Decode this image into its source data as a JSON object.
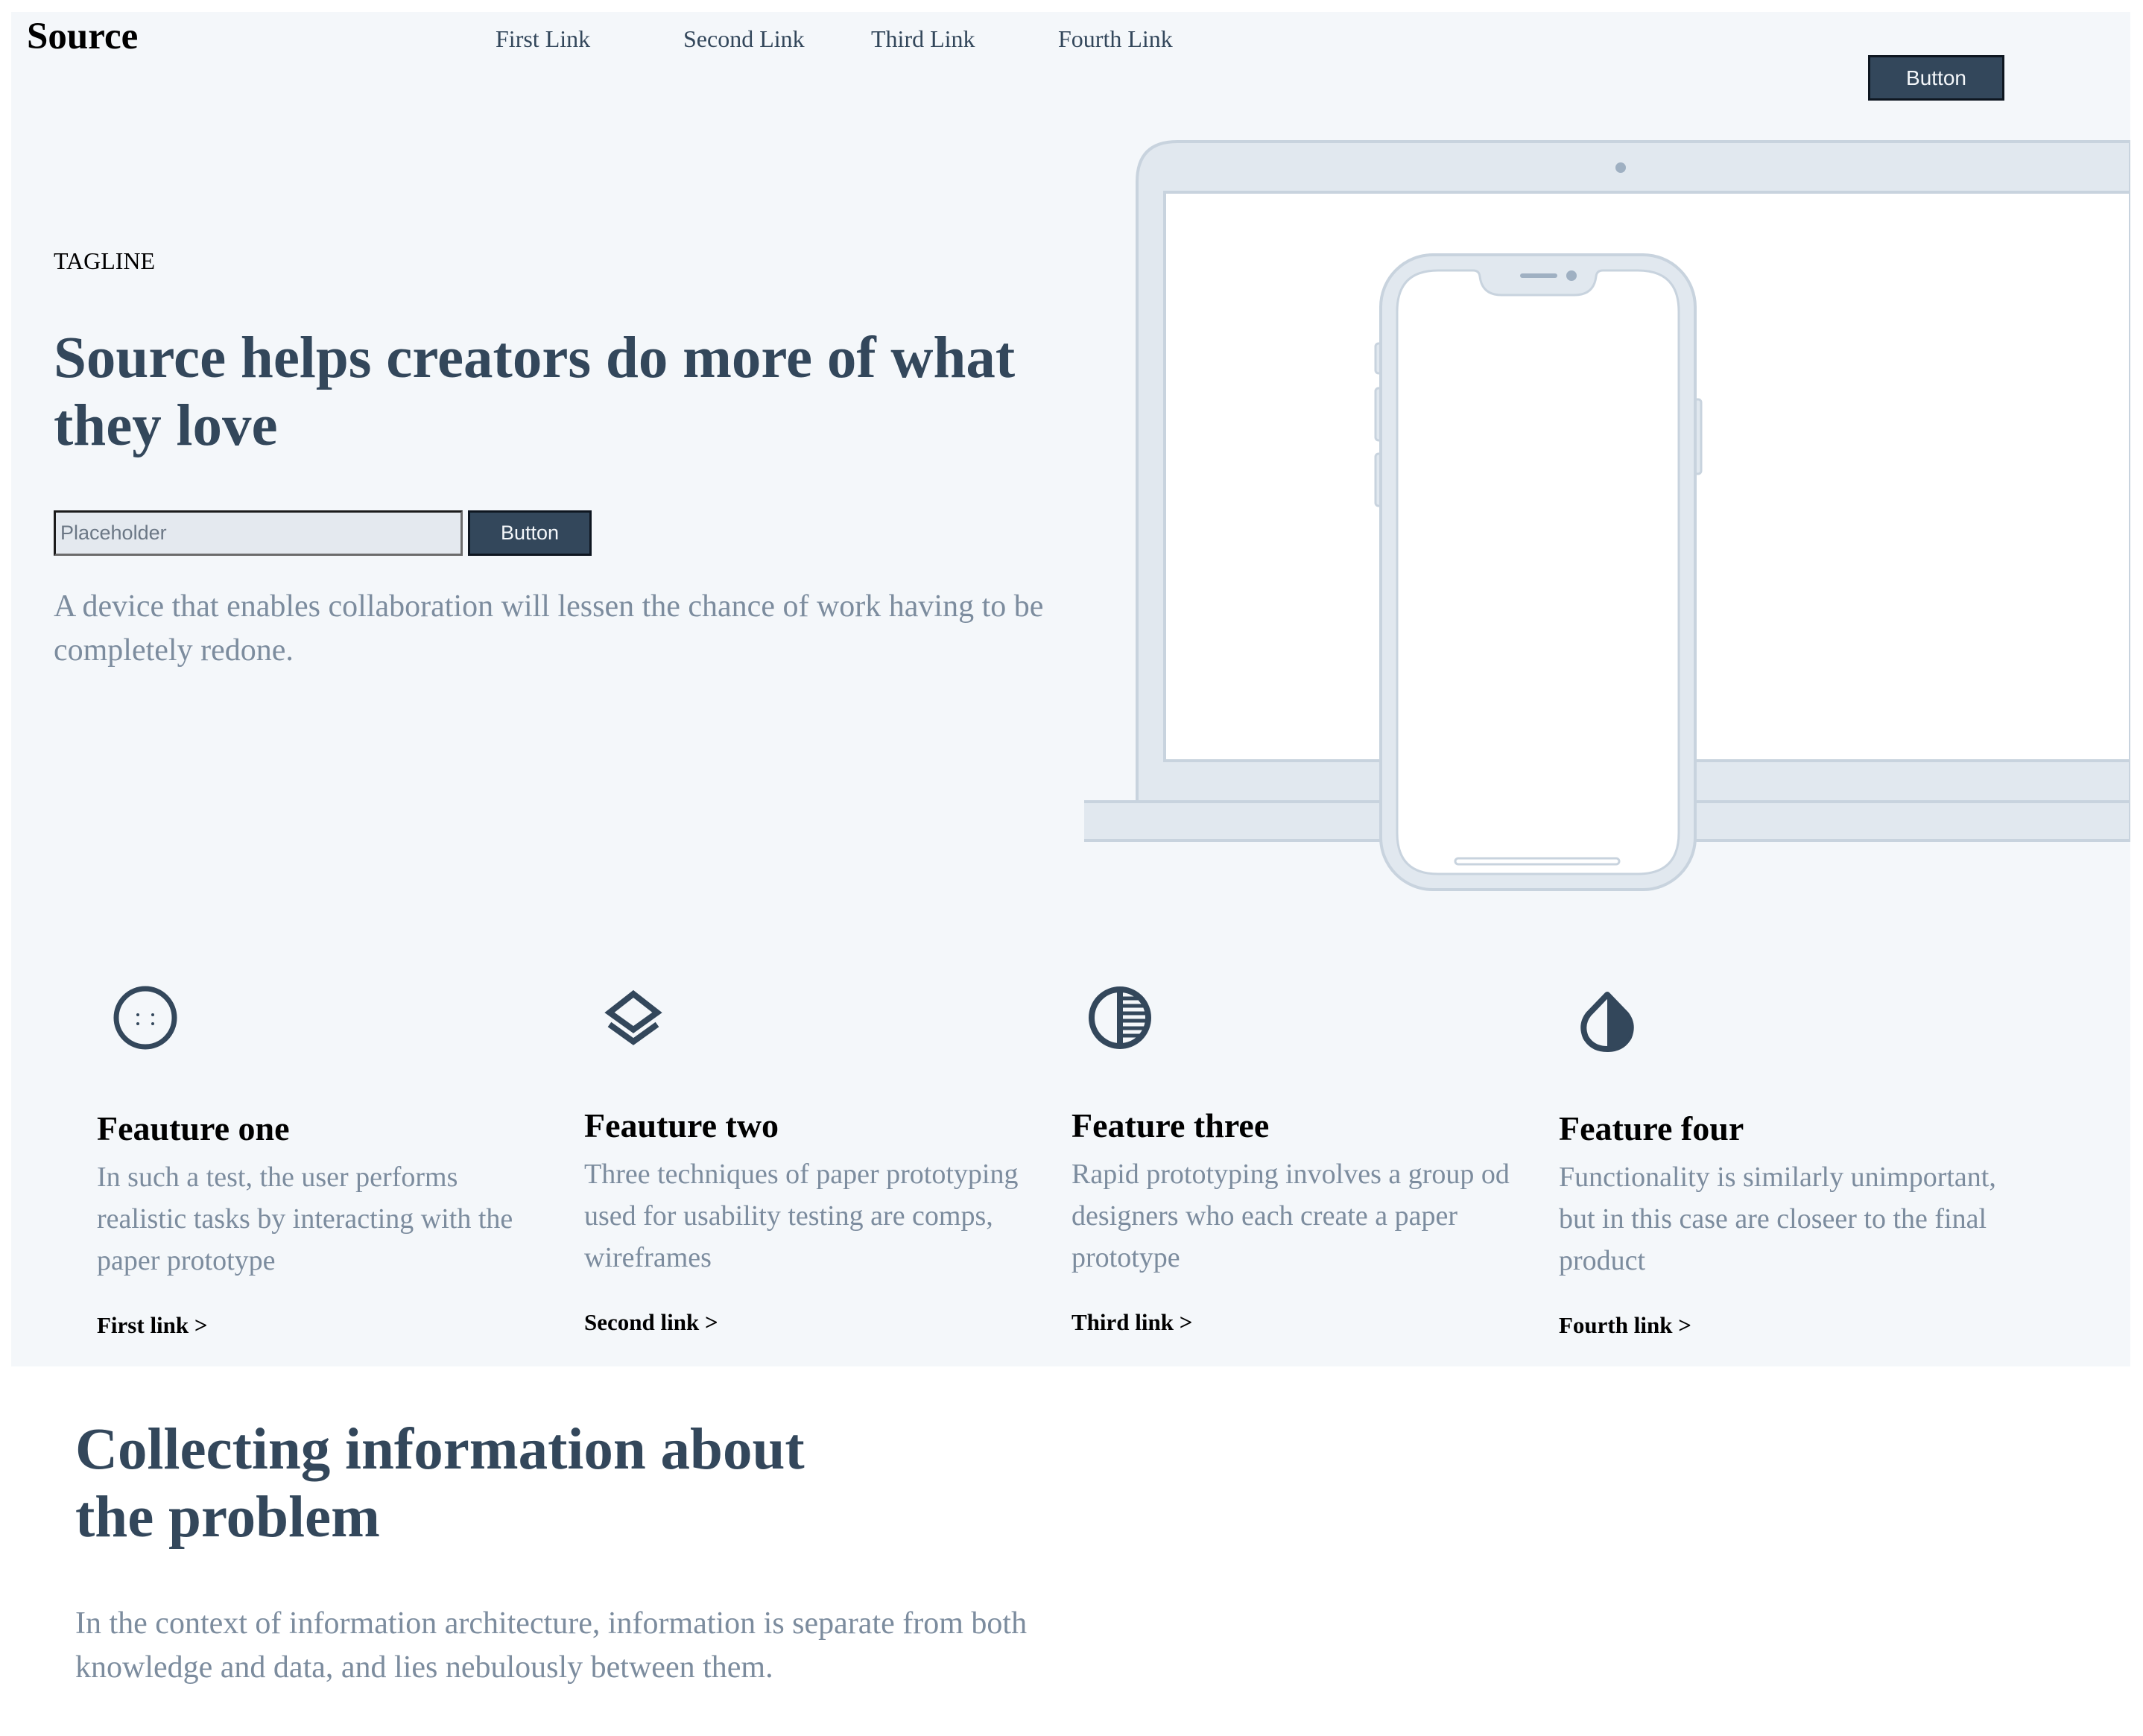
{
  "nav": {
    "logo": "Source",
    "links": [
      "First Link",
      "Second Link",
      "Third Link",
      "Fourth Link"
    ],
    "button_label": "Button"
  },
  "hero": {
    "tagline": "TAGLINE",
    "headline": "Source helps creators do more of what they love",
    "input_placeholder": "Placeholder",
    "button_label": "Button",
    "description": "A device that enables collaboration will lessen the chance of work having to be completely redone."
  },
  "features": [
    {
      "icon": "smiley-circle-icon",
      "title": "Feauture one",
      "description": "In such a test, the user performs realistic tasks by interacting with the paper prototype",
      "link": "First link >"
    },
    {
      "icon": "layers-icon",
      "title": "Feauture two",
      "description": "Three techniques of paper prototyping used for usability testing are comps, wireframes",
      "link": "Second link >"
    },
    {
      "icon": "half-striped-circle-icon",
      "title": "Feature three",
      "description": "Rapid prototyping involves a group od designers who each create a paper prototype",
      "link": "Third link >"
    },
    {
      "icon": "contrast-drop-icon",
      "title": "Feature four",
      "description": "Functionality is similarly unimportant, but in this case are closeer to the final product",
      "link": "Fourth link >"
    }
  ],
  "info_section": {
    "title": "Collecting information about the problem",
    "description": "In the context of information architecture, information is separate from both knowledge and data, and lies nebulously between them."
  },
  "colors": {
    "primary": "#33475b",
    "hero_background": "#f4f7fa",
    "muted_text": "#7c8c9e",
    "device_fill": "#e1e8ef",
    "device_stroke": "#c8d3de"
  }
}
